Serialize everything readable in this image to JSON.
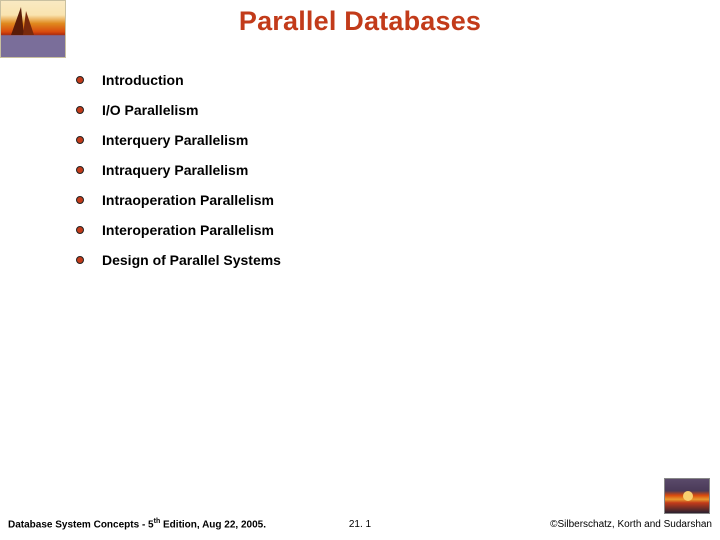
{
  "title": "Parallel Databases",
  "bullets": [
    "Introduction",
    "I/O Parallelism",
    "Interquery Parallelism",
    "Intraquery Parallelism",
    "Intraoperation Parallelism",
    "Interoperation Parallelism",
    "Design of Parallel Systems"
  ],
  "footer": {
    "left_prefix": "Database System Concepts - 5",
    "left_suffix": " Edition, Aug 22, 2005.",
    "left_sup": "th",
    "center": "21. 1",
    "right": "©Silberschatz, Korth and Sudarshan"
  }
}
